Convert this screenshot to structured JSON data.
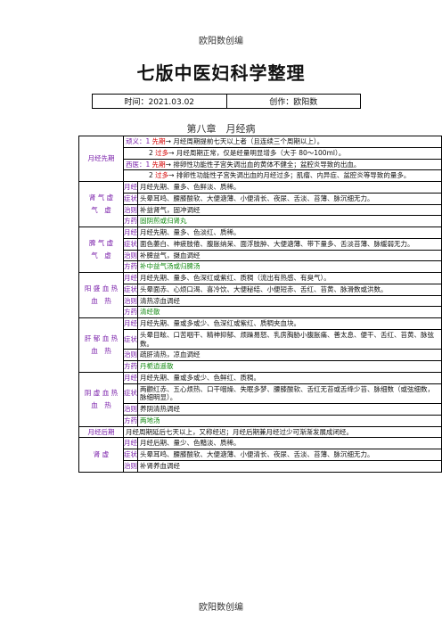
{
  "header_top": "欧阳数创编",
  "title": "七版中医妇科学整理",
  "meta": {
    "time": "时间：2021.03.02",
    "author": "创作：欧阳数"
  },
  "chapter": "第八章　月经病",
  "footer": "欧阳数创编",
  "sections": [
    {
      "title": "月经先期",
      "lines": [
        {
          "prefix": "顽义：1 ",
          "term": "先期",
          "text": "→ 月经周期提前七天以上者（且连续三个周期以上）。"
        },
        {
          "prefix": "2 ",
          "term": "过多",
          "text": "→ 月经周期正常，仅是经量明显增多（大于 80～100ml）。"
        },
        {
          "prefix": "西医：1 ",
          "term": "先期",
          "text": "→ 排卵性功能性子宫失调出血的黄体不健全；盆腔炎导致的出血。"
        },
        {
          "prefix": "2 ",
          "term": "过多",
          "text": "→ 排卵性功能性子宫失调出血的月经过多；肌瘤、内异症、盆腔炎等导致的量多。"
        }
      ]
    }
  ],
  "syndromes": [
    {
      "name": "脾 气 虚\n气 虚",
      "jing": "月经先期、量多、色鲜淡、质稀。",
      "zheng": "头晕耳鸣、腰膝酸软、大便溏薄、小便清长、夜尿、舌淡、苔薄、脉沉细无力。",
      "zhize": "补益肾气，固冲调经",
      "fangyao": "固阴煎或归肾丸"
    },
    {
      "name": "脾 气 虚\n气 虚",
      "jing": "月经先期、量多、色淡红、质稀。",
      "zheng": "面色萎白、神疲肢倦、腹胀纳呆、面浮肢肿、大便溏薄、带下量多、舌淡苔薄、脉缓弱无力。",
      "zhize": "补脾益气，摄血调经",
      "fangyao": "补中益气汤或归脾汤"
    },
    {
      "name": "阳 盛 血 热\n血 热",
      "jing": "月经先期、量多、色深红或紫红、质稠（流出有热感、有臭气）。",
      "zheng": "头晕面赤、心烦口渴、喜冷饮、大便秘结、小便短赤、舌红、苔黄、脉滑数或洪数。",
      "zhize": "清热凉血调经",
      "fangyao": "清经散"
    },
    {
      "name": "肝 郁 血 热\n血 热",
      "jing": "月经先期、量或多或少、色深红或紫红、质稠夹血块。",
      "zheng": "头晕目眩、口苦咽干、精神抑郁、烦躁易怒、乳房胸胁小腹胀痛、善太息、便干、舌红、苔黄、脉弦数。",
      "zhize": "疏肝清热，凉血调经",
      "fangyao": "丹栀逍遥散"
    },
    {
      "name": "阴 虚 血 热\n血 热",
      "jing": "月经先期、量或多或少、色鲜红、质稠。",
      "zheng": "两颧红赤、五心烦热、口干咽燥、失眠多梦、腰膝酸软、舌红无苔或舌绛少苔、脉细数（或弦细数，脉细明显）。",
      "zhize": "养阴清热调经",
      "fangyao": "两地汤"
    }
  ],
  "labels": {
    "jing": "月经",
    "zheng": "症状",
    "zhize": "治则",
    "fangyao": "方药"
  },
  "houqi": {
    "title": "月经后期",
    "text": "月经周期延后七天以上，又称经迟；月经后期兼月经过少可渐渐发展成闭经。"
  },
  "shenxu": {
    "name": "肾 虚",
    "jing": "月经后期、量少、色黯淡、质稀。",
    "zheng": "头晕耳鸣、腰膝酸软、大便溏薄、小便清长、夜尿、舌淡、苔薄、脉沉细无力。",
    "zhize": "补肾养血调经"
  }
}
